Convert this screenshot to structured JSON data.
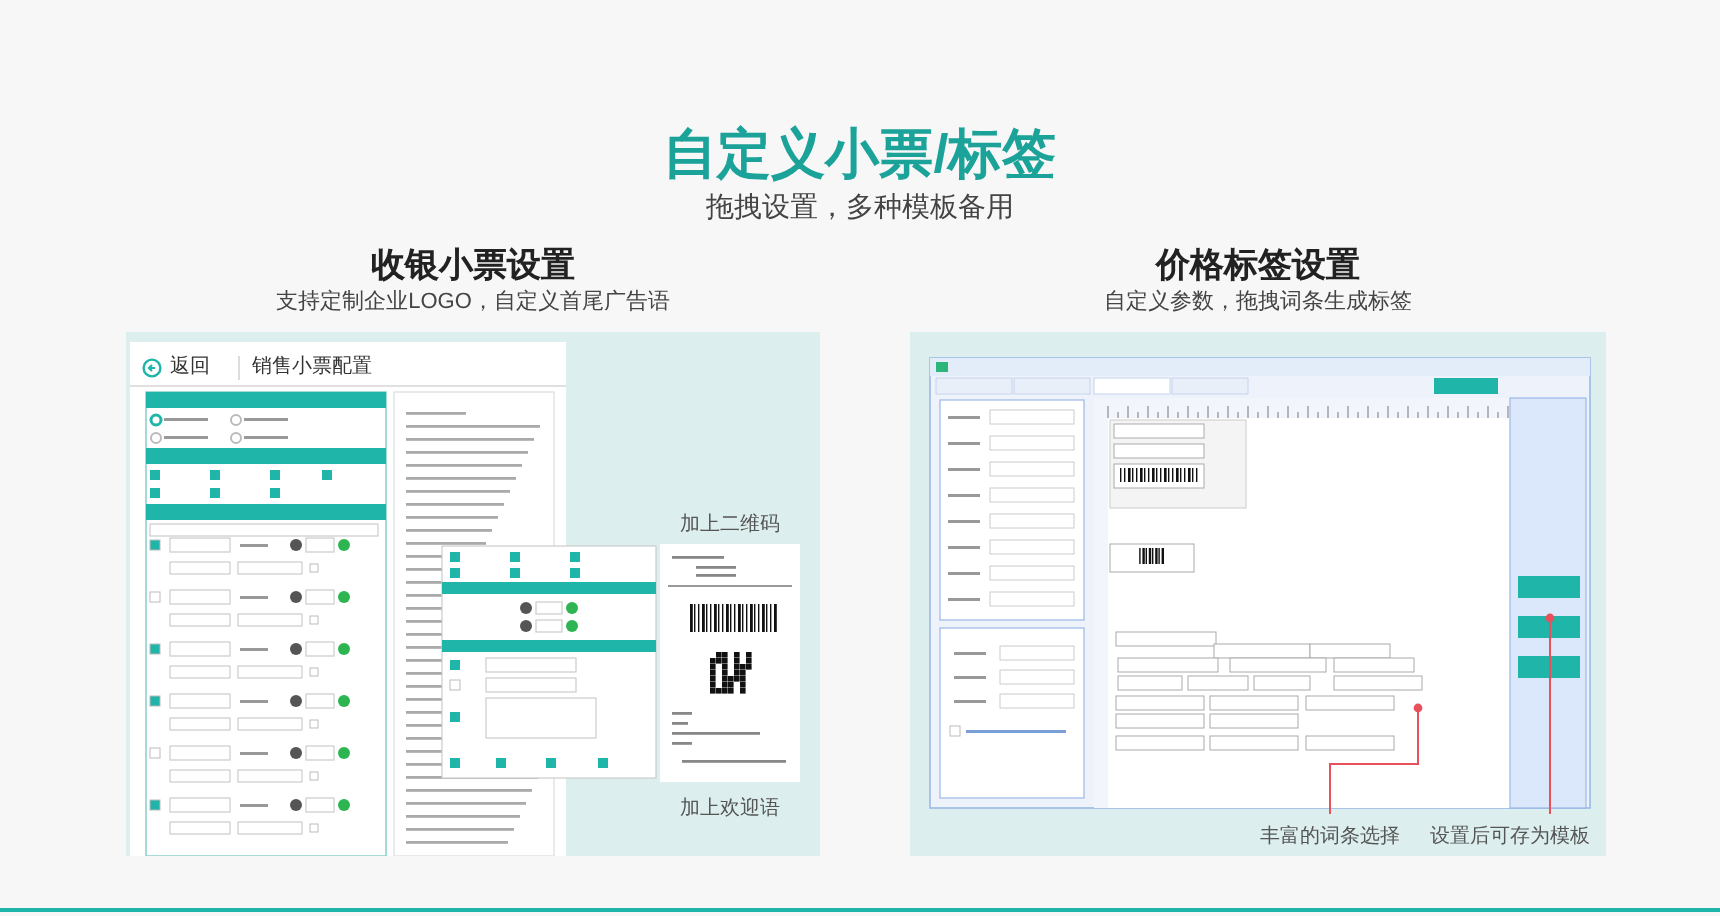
{
  "header": {
    "title": "自定义小票/标签",
    "subtitle": "拖拽设置，多种模板备用"
  },
  "sections": [
    {
      "kind": "receipt",
      "title": "收银小票设置",
      "subtitle": "支持定制企业LOGO，自定义首尾广告语",
      "app_header": {
        "back": "返回",
        "title": "销售小票配置"
      },
      "callouts": [
        "加上二维码",
        "加上欢迎语"
      ]
    },
    {
      "kind": "label",
      "title": "价格标签设置",
      "subtitle": "自定义参数，拖拽词条生成标签",
      "callouts": [
        "丰富的词条选择",
        "设置后可存为模板"
      ]
    }
  ]
}
